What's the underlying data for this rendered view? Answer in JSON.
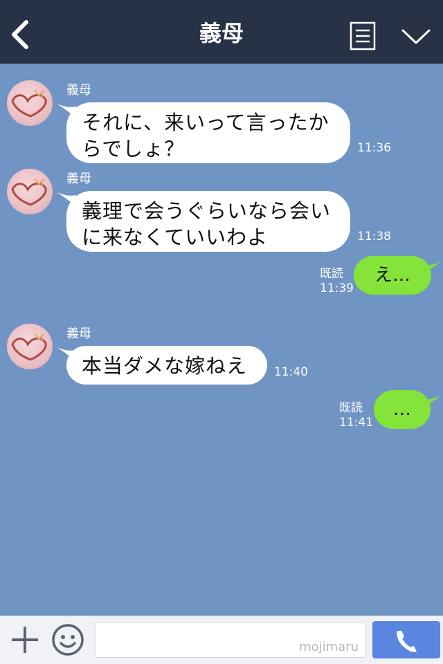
{
  "header": {
    "title": "義母",
    "colors": {
      "background": "#273246",
      "text": "#ffffff"
    },
    "icons": [
      "chevron-left-icon",
      "document-icon",
      "chevron-down-icon"
    ]
  },
  "chat": {
    "background": "#7094c4",
    "messages": [
      {
        "direction": "incoming",
        "sender": "義母",
        "lines": [
          "それに、来いって言ったか",
          "らでしょ？"
        ],
        "time": "11:36"
      },
      {
        "direction": "incoming",
        "sender": "義母",
        "lines": [
          "義理で会うぐらいなら会い",
          "に来なくていいわよ"
        ],
        "time": "11:38"
      },
      {
        "direction": "outgoing",
        "text": "え…",
        "read": "既読",
        "time": "11:39"
      },
      {
        "direction": "incoming",
        "sender": "義母",
        "lines": [
          "本当ダメな嫁ねえ"
        ],
        "time": "11:40"
      },
      {
        "direction": "outgoing",
        "text": "…",
        "read": "既読",
        "time": "11:41"
      }
    ],
    "colors": {
      "incoming_bubble": "#ffffff",
      "outgoing_bubble": "#84e43a"
    }
  },
  "footer": {
    "input_value": "",
    "watermark": "mojimaru",
    "icons": [
      "plus-icon",
      "emoji-icon",
      "phone-icon"
    ],
    "colors": {
      "call_button": "#5b86e0"
    }
  }
}
